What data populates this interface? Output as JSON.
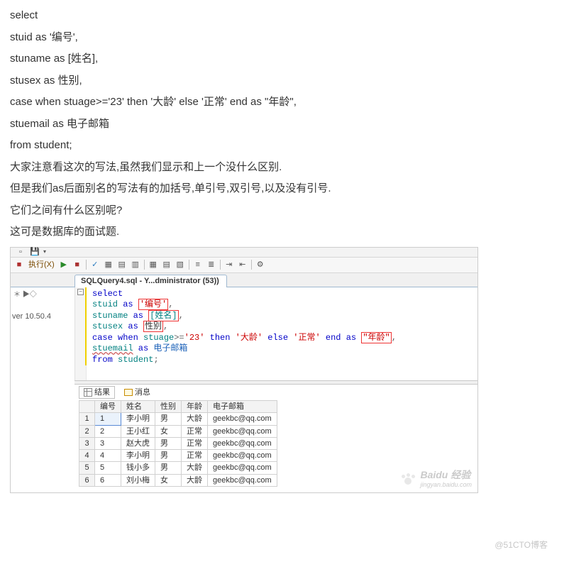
{
  "article_lines": [
    "select",
    "stuid as '编号',",
    "stuname as [姓名],",
    "stusex as 性别,",
    "case when stuage>='23' then '大龄' else '正常' end as \"年龄\",",
    "stuemail as 电子邮箱",
    "from student;",
    "大家注意看这次的写法,虽然我们显示和上一个没什么区别.",
    "但是我们as后面别名的写法有的加括号,单引号,双引号,以及没有引号.",
    "它们之间有什么区别呢?",
    "这可是数据库的面试题."
  ],
  "ide": {
    "execute_label": "执行(X)",
    "version_label": "ver 10.50.4",
    "tab_title": "SQLQuery4.sql - Y...dministrator (53))",
    "code": {
      "l1": "select",
      "l2a": "stuid ",
      "l2b": "as ",
      "l2c": "'编号'",
      "l2d": ",",
      "l3a": "stuname ",
      "l3b": "as ",
      "l3c": "[姓名]",
      "l3d": ",",
      "l4a": "stusex ",
      "l4b": "as ",
      "l4c": "性别",
      "l4d": ",",
      "l5a": "case when ",
      "l5b": "stuage",
      "l5c": ">=",
      "l5d": "'23'",
      "l5e": " then ",
      "l5f": "'大龄'",
      "l5g": " else ",
      "l5h": "'正常'",
      "l5i": " end as ",
      "l5j": "\"年龄\"",
      "l5k": ",",
      "l6a": "stuemail",
      "l6b": " as ",
      "l6c": "电子邮箱",
      "l7a": "from ",
      "l7b": "student",
      "l7c": ";"
    },
    "results_tab": "结果",
    "messages_tab": "消息",
    "columns": [
      "",
      "编号",
      "姓名",
      "性别",
      "年龄",
      "电子邮箱"
    ],
    "rows": [
      [
        "1",
        "1",
        "李小明",
        "男",
        "大龄",
        "geekbc@qq.com"
      ],
      [
        "2",
        "2",
        "王小红",
        "女",
        "正常",
        "geekbc@qq.com"
      ],
      [
        "3",
        "3",
        "赵大虎",
        "男",
        "正常",
        "geekbc@qq.com"
      ],
      [
        "4",
        "4",
        "李小明",
        "男",
        "正常",
        "geekbc@qq.com"
      ],
      [
        "5",
        "5",
        "钱小多",
        "男",
        "大龄",
        "geekbc@qq.com"
      ],
      [
        "6",
        "6",
        "刘小梅",
        "女",
        "大龄",
        "geekbc@qq.com"
      ]
    ]
  },
  "watermark_primary": "Baidu 经验",
  "watermark_secondary": "jingyan.baidu.com",
  "watermark_blog": "@51CTO博客"
}
